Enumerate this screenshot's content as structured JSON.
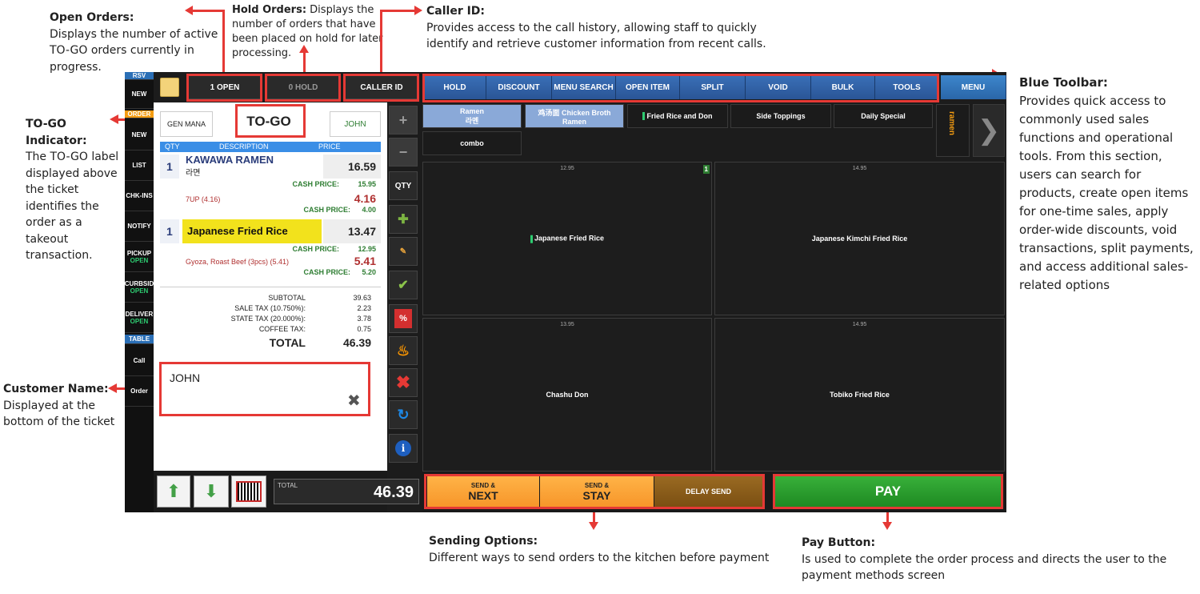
{
  "annotations": {
    "open_orders": {
      "title": "Open Orders:",
      "text": "Displays the number of active TO-GO orders currently in progress."
    },
    "hold_orders": {
      "title": "Hold Orders:",
      "text": "Displays the number of orders that have been placed on hold for later processing."
    },
    "caller_id": {
      "title": "Caller ID:",
      "text": "Provides access to the call history, allowing staff to quickly identify and retrieve customer information from recent calls."
    },
    "togo": {
      "title": "TO-GO Indicator:",
      "text": "The TO-GO label displayed above the ticket identifies the order as a takeout transaction."
    },
    "customer_name": {
      "title": "Customer Name:",
      "text": "Displayed at the bottom of the ticket"
    },
    "blue_toolbar": {
      "title": "Blue Toolbar:",
      "text": "Provides quick access to commonly used sales functions and operational tools. From this section, users can search for products, create open items for one-time sales, apply order-wide discounts, void transactions, split payments, and access additional sales-related options"
    },
    "sending": {
      "title": "Sending Options:",
      "text": "Different ways to send orders to the kitchen before payment"
    },
    "pay": {
      "title": "Pay Button:",
      "text": "Is used to complete the order process and directs the user to the payment methods screen"
    }
  },
  "leftnav": [
    "RSV",
    "NEW",
    "ORDER",
    "NEW",
    "LIST",
    "CHK-INS",
    "NOTIFY",
    "PICKUP",
    "CURBSID",
    "DELIVER",
    "TABLE",
    "Call",
    "Order"
  ],
  "leftnav_sub": {
    "pickup": "OPEN",
    "curbside": "OPEN",
    "deliver": "OPEN"
  },
  "top_buttons": {
    "open": "1 OPEN",
    "hold": "0 HOLD",
    "caller": "CALLER ID"
  },
  "toolbar": [
    "HOLD",
    "DISCOUNT",
    "MENU SEARCH",
    "OPEN ITEM",
    "SPLIT",
    "VOID",
    "BULK",
    "TOOLS"
  ],
  "menu_btn": "MENU",
  "ticket": {
    "server": "GEN MANA",
    "togo": "TO-GO",
    "customer_tab": "JOHN",
    "col_qty": "QTY",
    "col_desc": "DESCRIPTION",
    "col_price": "PRICE",
    "items": [
      {
        "qty": "1",
        "name": "KAWAWA RAMEN",
        "sub": "라면",
        "price": "16.59",
        "cash_label": "CASH PRICE:",
        "cash": "15.95"
      },
      {
        "mod": "7UP (4.16)",
        "price": "4.16",
        "cash_label": "CASH PRICE:",
        "cash": "4.00"
      },
      {
        "qty": "1",
        "name": "Japanese Fried Rice",
        "price": "13.47",
        "cash_label": "CASH PRICE:",
        "cash": "12.95"
      },
      {
        "mod": "Gyoza, Roast Beef (3pcs) (5.41)",
        "price": "5.41",
        "cash_label": "CASH PRICE:",
        "cash": "5.20"
      }
    ],
    "subtotal_label": "SUBTOTAL",
    "subtotal": "39.63",
    "sale_tax_label": "SALE TAX (10.750%):",
    "sale_tax": "2.23",
    "state_tax_label": "STATE TAX (20.000%):",
    "state_tax": "3.78",
    "coffee_tax_label": "COFFEE TAX:",
    "coffee_tax": "0.75",
    "total_label": "TOTAL",
    "total": "46.39",
    "customer_name": "JOHN",
    "bottom_total_label": "TOTAL",
    "bottom_total": "46.39"
  },
  "side_buttons": {
    "qty": "QTY"
  },
  "categories": [
    {
      "line1": "Ramen",
      "line2": "라멘"
    },
    {
      "line1": "鸡汤面 Chicken Broth",
      "line2": "Ramen"
    },
    {
      "line1": "Fried Rice and Don"
    },
    {
      "line1": "Side Toppings"
    },
    {
      "line1": "Daily Special"
    },
    {
      "line1": "combo"
    }
  ],
  "ramen_tab": "ramen",
  "tiles": [
    {
      "price": "12.95",
      "name": "Japanese Fried Rice",
      "badge": "1"
    },
    {
      "price": "14.95",
      "name": "Japanese Kimchi Fried Rice"
    },
    {
      "price": "13.95",
      "name": "Chashu Don"
    },
    {
      "price": "14.95",
      "name": "Tobiko Fried Rice"
    }
  ],
  "send": {
    "next_top": "SEND &",
    "next": "NEXT",
    "stay_top": "SEND &",
    "stay": "STAY",
    "delay": "DELAY SEND"
  },
  "pay": "PAY"
}
